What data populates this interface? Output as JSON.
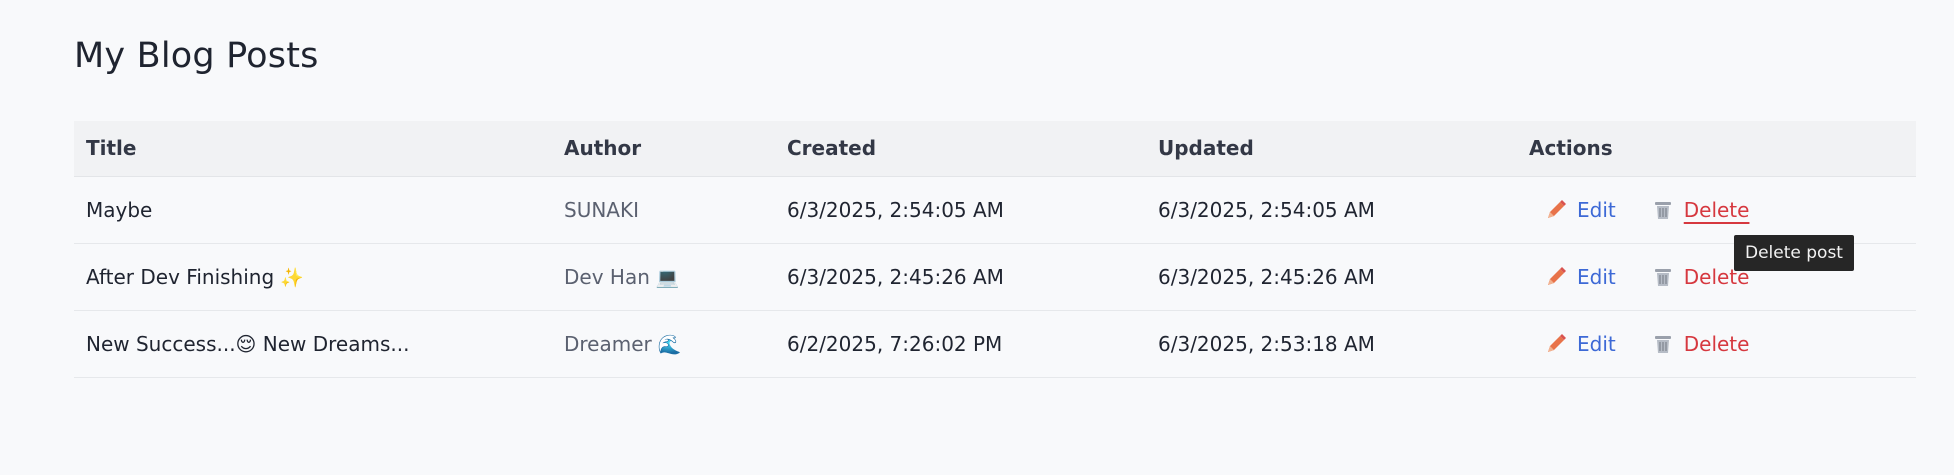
{
  "page": {
    "title": "My Blog Posts"
  },
  "table": {
    "headers": [
      "Title",
      "Author",
      "Created",
      "Updated",
      "Actions"
    ],
    "rows": [
      {
        "title": "Maybe",
        "title_emoji": "",
        "author": "SUNAKI",
        "author_emoji": "",
        "created": "6/3/2025, 2:54:05 AM",
        "updated": "6/3/2025, 2:54:05 AM"
      },
      {
        "title": "After Dev Finishing",
        "title_emoji": "✨",
        "author": "Dev Han",
        "author_emoji": "💻",
        "created": "6/3/2025, 2:45:26 AM",
        "updated": "6/3/2025, 2:45:26 AM"
      },
      {
        "title": "New Success...😌 New Dreams...",
        "title_emoji": "",
        "author": "Dreamer",
        "author_emoji": "🌊",
        "created": "6/2/2025, 7:26:02 PM",
        "updated": "6/3/2025, 2:53:18 AM"
      }
    ]
  },
  "actions": {
    "edit_label": "Edit",
    "delete_label": "Delete",
    "edit_icon": "pencil-icon",
    "delete_icon": "wastebasket-icon"
  },
  "tooltip": {
    "text": "Delete post"
  },
  "colors": {
    "edit": "#3d69d6",
    "delete": "#d6383f",
    "pencil": "#e8734a",
    "tooltip_bg": "#262626"
  }
}
